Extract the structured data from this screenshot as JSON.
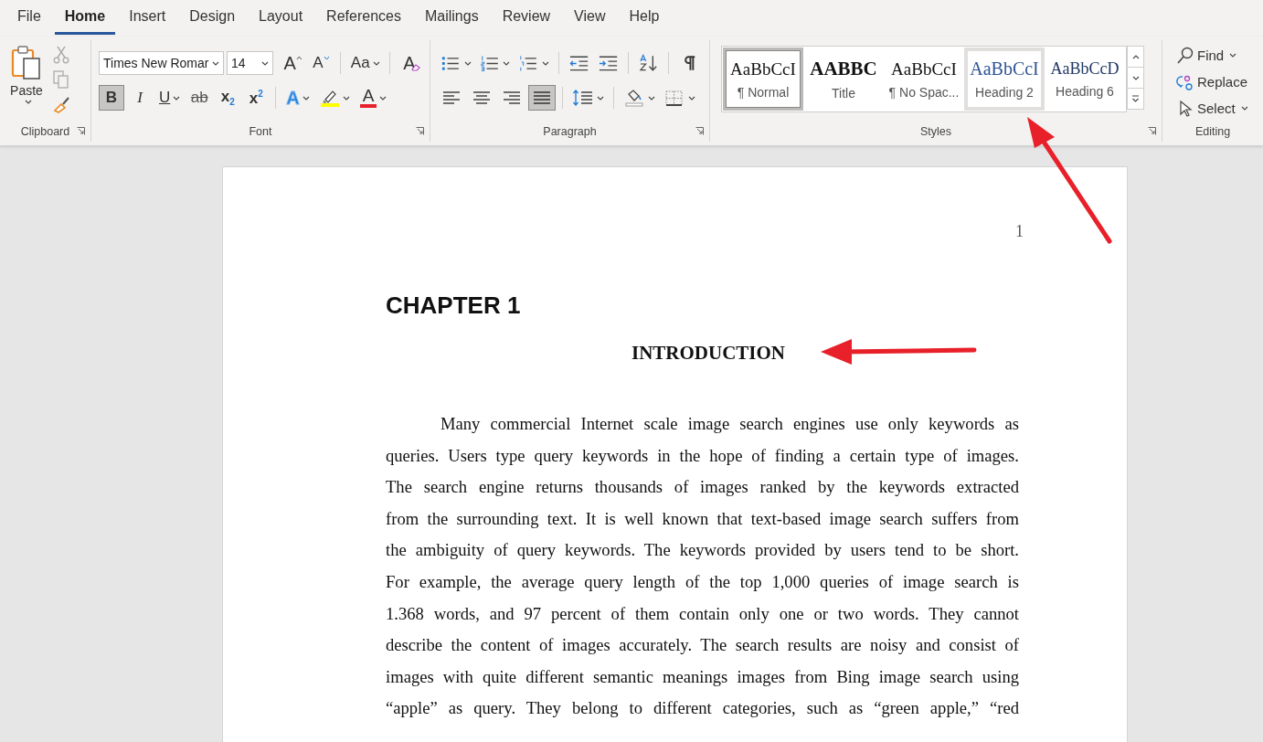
{
  "menu_tabs": [
    {
      "label": "File",
      "selected": false
    },
    {
      "label": "Home",
      "selected": true
    },
    {
      "label": "Insert",
      "selected": false
    },
    {
      "label": "Design",
      "selected": false
    },
    {
      "label": "Layout",
      "selected": false
    },
    {
      "label": "References",
      "selected": false
    },
    {
      "label": "Mailings",
      "selected": false
    },
    {
      "label": "Review",
      "selected": false
    },
    {
      "label": "View",
      "selected": false
    },
    {
      "label": "Help",
      "selected": false
    }
  ],
  "clipboard": {
    "paste_label": "Paste",
    "group_label": "Clipboard"
  },
  "font": {
    "font_name": "Times New Romar",
    "font_size": "14",
    "group_label": "Font",
    "row1": [
      {
        "kind": "grow",
        "glyph": "A"
      },
      {
        "kind": "shrink",
        "glyph": "A"
      },
      {
        "kind": "case",
        "glyph": "Aa"
      },
      {
        "kind": "clear",
        "glyph": "A"
      }
    ],
    "row2": [
      {
        "kind": "bold",
        "glyph": "B",
        "on": true
      },
      {
        "kind": "italic",
        "glyph": "I",
        "on": false
      },
      {
        "kind": "underline",
        "glyph": "U",
        "on": false
      },
      {
        "kind": "strike",
        "glyph": "ab",
        "on": false
      },
      {
        "kind": "subscript",
        "glyph": "x$_{2}$",
        "on": false
      },
      {
        "kind": "superscript",
        "glyph": "x$^{2}$",
        "on": false
      },
      {
        "kind": "effects",
        "glyph": "A",
        "on": false
      },
      {
        "kind": "highlight",
        "on": false
      },
      {
        "kind": "color",
        "glyph": "A",
        "on": false
      }
    ]
  },
  "paragraph": {
    "group_label": "Paragraph",
    "row1": [
      {
        "kind": "bullets",
        "on": false
      },
      {
        "kind": "numbering",
        "on": false
      },
      {
        "kind": "multilevel",
        "on": false
      },
      {
        "kind": "outdent",
        "on": false
      },
      {
        "kind": "indent",
        "on": false
      },
      {
        "kind": "sort",
        "on": false
      },
      {
        "kind": "marks",
        "on": false
      }
    ],
    "row2": [
      {
        "kind": "align-left",
        "on": false
      },
      {
        "kind": "align-center",
        "on": false
      },
      {
        "kind": "align-right",
        "on": false
      },
      {
        "kind": "justify",
        "on": true
      },
      {
        "kind": "spacing",
        "on": false
      },
      {
        "kind": "shading",
        "on": false
      },
      {
        "kind": "borders",
        "on": false
      }
    ]
  },
  "styles": {
    "group_label": "Styles",
    "items": [
      {
        "kind": "normal",
        "preview": "AaBbCcI",
        "label": "¶ Normal",
        "selected": true,
        "hovered": false
      },
      {
        "kind": "title",
        "preview": "AABBC",
        "label": "Title",
        "selected": false,
        "hovered": false
      },
      {
        "kind": "nospacing",
        "preview": "AaBbCcI",
        "label": "¶ No Spac...",
        "selected": false,
        "hovered": false
      },
      {
        "kind": "heading2",
        "preview": "AaBbCcI",
        "label": "Heading 2",
        "selected": false,
        "hovered": true
      },
      {
        "kind": "heading6",
        "preview": "AaBbCcD",
        "label": "Heading 6",
        "selected": false,
        "hovered": false
      }
    ]
  },
  "editing": {
    "group_label": "Editing",
    "items": [
      {
        "kind": "find",
        "label": "Find"
      },
      {
        "kind": "replace",
        "label": "Replace"
      },
      {
        "kind": "select",
        "label": "Select"
      }
    ]
  },
  "document": {
    "page_number": "1",
    "chapter": "CHAPTER 1",
    "heading": "INTRODUCTION",
    "paragraph_lines": [
      "Many commercial Internet scale image search engines use only keywords as",
      "queries. Users type query keywords in the hope of finding a certain type of images.",
      "The search engine returns thousands of images ranked by the keywords extracted",
      "from the surrounding text. It is well known that text-based image search suffers from",
      "the ambiguity of query keywords. The keywords provided by users tend to be short.",
      "For example, the average query length of the top 1,000 queries of image search is",
      "1.368 words, and 97 percent of them contain only one or two words. They cannot",
      "describe the content of images accurately. The search results are noisy and consist of",
      "images with quite different semantic meanings images from Bing image search using",
      "“apple” as query. They belong to different categories, such as “green apple,” “red"
    ]
  }
}
